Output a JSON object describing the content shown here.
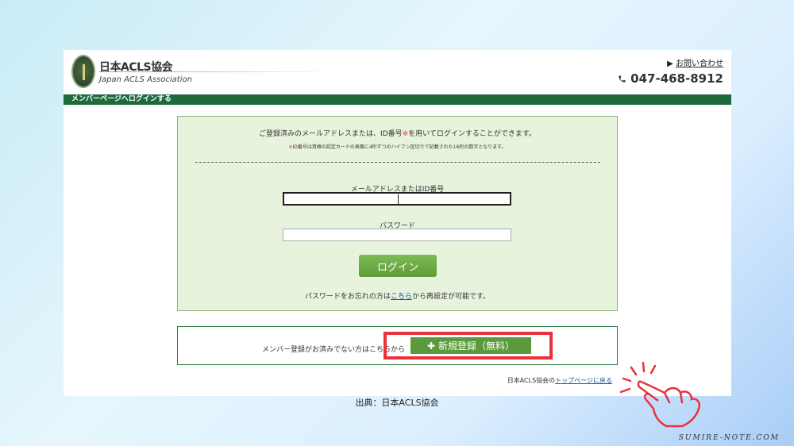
{
  "header": {
    "logo_jp": "日本ACLS協会",
    "logo_en": "Japan ACLS Association",
    "seal_text": "JAPAN ACLS",
    "contact_arrow": "▶",
    "contact_label": "お問い合わせ",
    "phone_icon": "phone-icon",
    "phone_number": "047-468-8912"
  },
  "section_title": "メンバーページへログインする",
  "login": {
    "intro_before": "ご登録済みのメールアドレスまたは、ID番号",
    "intro_mark": "※",
    "intro_after": "を用いてログインすることができます。",
    "note_mark": "※",
    "note_text": "ID番号は資格の認定カードの表面に4桁ずつのハイフン区切りで記載された16桁の数字となります。",
    "email_label": "メールアドレスまたはID番号",
    "email_value": "",
    "password_label": "パスワード",
    "password_value": "",
    "login_button": "ログイン",
    "forgot_before": "パスワードをお忘れの方は",
    "forgot_link": "こちら",
    "forgot_after": "から再設定が可能です。"
  },
  "register": {
    "text": "メンバー登録がお済みでない方はこちらから",
    "plus_icon": "✚",
    "button_label": "新規登録（無料）"
  },
  "footer": {
    "before": "日本ACLS協会の",
    "link": "トップページに戻る"
  },
  "caption": "出典：日本ACLS協会",
  "watermark": "SUMIRE-NOTE.COM",
  "colors": {
    "header_bar": "#1d6b3b",
    "login_bg": "#e8f3de",
    "button_green": "#5a9a3a",
    "highlight_red": "#e8323c"
  }
}
